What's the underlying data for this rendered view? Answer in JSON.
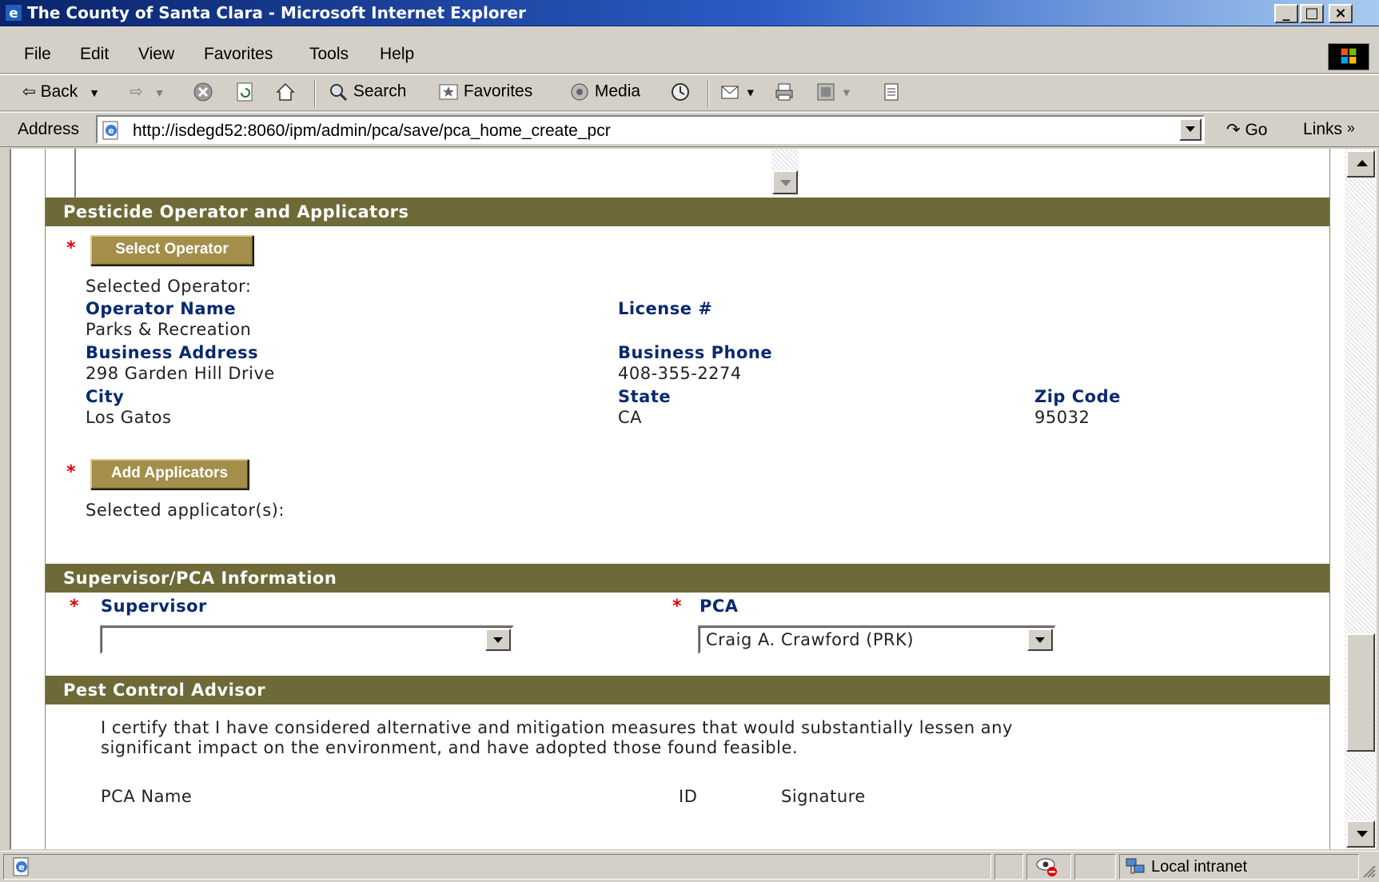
{
  "window": {
    "title": "The County of Santa Clara - Microsoft Internet Explorer",
    "controls": [
      "_",
      "□",
      "×"
    ]
  },
  "menu": [
    "File",
    "Edit",
    "View",
    "Favorites",
    "Tools",
    "Help"
  ],
  "toolbar": {
    "back": "Back",
    "search": "Search",
    "favorites": "Favorites",
    "media": "Media"
  },
  "address": {
    "label": "Address",
    "url": "http://isdegd52:8060/ipm/admin/pca/save/pca_home_create_pcr",
    "go": "Go",
    "links": "Links"
  },
  "page": {
    "operators_section": {
      "title": "Pesticide Operator and Applicators",
      "select_operator_button": "Select Operator",
      "selected_operator_label": "Selected Operator:",
      "operator_name_label": "Operator Name",
      "operator_name": "Parks & Recreation",
      "license_label": "License #",
      "license": "",
      "business_address_label": "Business Address",
      "business_address": "298 Garden Hill Drive",
      "business_phone_label": "Business Phone",
      "business_phone": "408-355-2274",
      "city_label": "City",
      "city": "Los Gatos",
      "state_label": "State",
      "state": "CA",
      "zip_label": "Zip Code",
      "zip": "95032",
      "add_applicators_button": "Add Applicators",
      "selected_applicators_label": "Selected applicator(s):"
    },
    "supervisor_section": {
      "title": "Supervisor/PCA Information",
      "supervisor_label": "Supervisor",
      "supervisor_value": "",
      "pca_label": "PCA",
      "pca_value": "Craig A. Crawford (PRK)"
    },
    "advisor_section": {
      "title": "Pest Control Advisor",
      "certification_line1": "I certify that I have considered alternative and mitigation measures that would substantially lessen any",
      "certification_line2": "significant impact on the environment, and have adopted those found feasible.",
      "pca_name_label": "PCA Name",
      "id_label": "ID",
      "signature_label": "Signature"
    },
    "required_marker": "*"
  },
  "status": {
    "zone": "Local intranet"
  },
  "colors": {
    "section_header": "#6e6a38",
    "label_blue": "#0a2a6e",
    "required_red": "#e00000",
    "button_olive": "#a38e4a"
  }
}
